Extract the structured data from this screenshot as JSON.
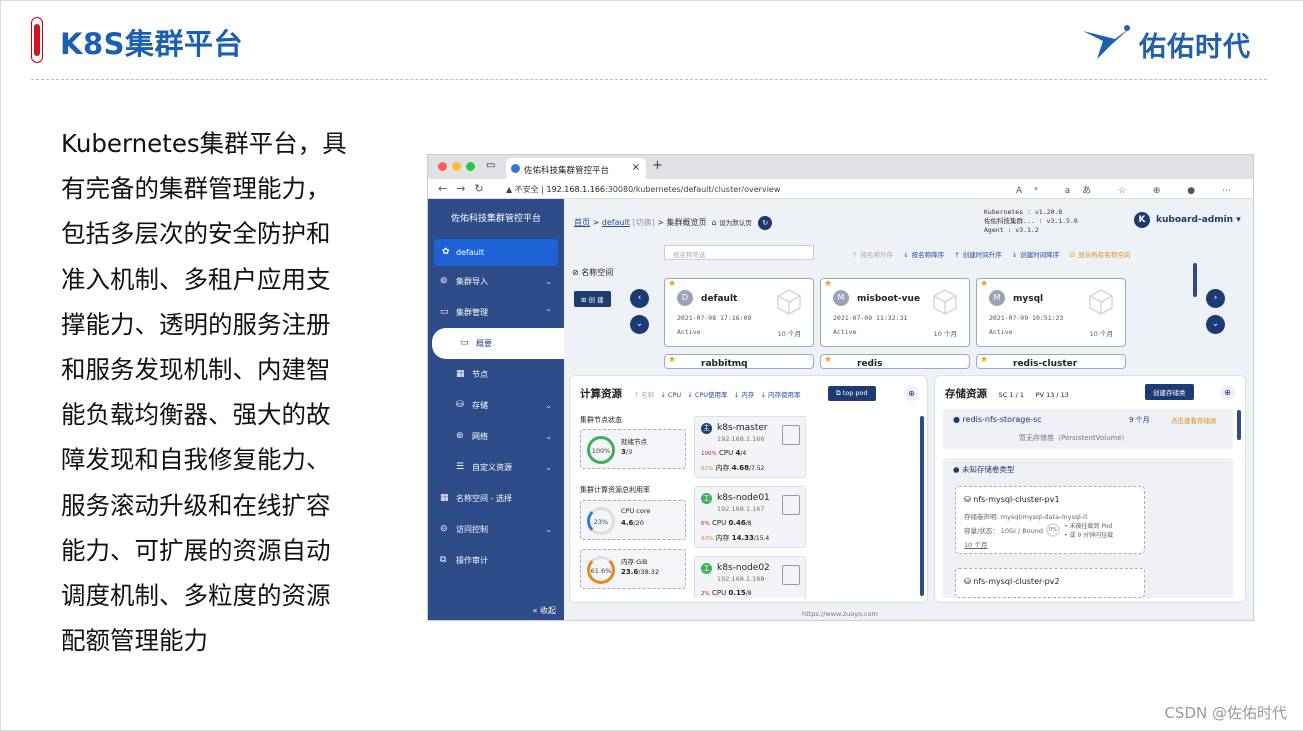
{
  "slide": {
    "title": "K8S集群平台",
    "logo_text": "佑佑时代",
    "body_lines": [
      "Kubernetes集群平台，具",
      "有完备的集群管理能力，",
      "包括多层次的安全防护和",
      "准入机制、多租户应用支",
      "撑能力、透明的服务注册",
      "和服务发现机制、内建智",
      "能负载均衡器、强大的故",
      "障发现和自我修复能力、",
      "服务滚动升级和在线扩容",
      "能力、可扩展的资源自动",
      "调度机制、多粒度的资源",
      "配额管理能力"
    ],
    "footer": "CSDN @佐佑时代"
  },
  "browser": {
    "tab_title": "佐佑科技集群管控平台",
    "insecure": "不安全",
    "url_host": "192.168.1.166",
    "url_rest": ":30080/kubernetes/default/cluster/overview",
    "status_url": "https://www.zuoyo.com"
  },
  "sidebar": {
    "brand": "佐佑科技集群管控平台",
    "selected_ns": "default",
    "items": [
      "集群导入",
      "集群管理",
      "概要",
      "节点",
      "存储",
      "网络",
      "自定义资源",
      "名称空间 - 选择",
      "访问控制",
      "操作审计"
    ],
    "collapse": "« 收起"
  },
  "header": {
    "bc_home": "首页",
    "bc_ns": "default",
    "bc_switch": "[切换]",
    "bc_page": "集群概览页",
    "bc_set_default": "设为默认页",
    "versions": [
      "Kubernetes    :  v1.20.8",
      "佐佑科技集群...  :  v3.1.5.0",
      "Agent         :  v3.1.2"
    ],
    "user": "kuboard-admin",
    "user_initial": "K"
  },
  "namespaces": {
    "label": "名称空间",
    "create": "创 建",
    "search_placeholder": "按名称筛选",
    "sorts": [
      "↑ 按名称升序",
      "↓ 按名称降序",
      "↑ 创建时间升序",
      "↓ 创建时间降序",
      "显示所有名称空间"
    ],
    "cards": [
      {
        "initial": "D",
        "name": "default",
        "created": "2021-07-08 17:16:09",
        "status": "Active",
        "age": "10 个月"
      },
      {
        "initial": "M",
        "name": "misboot-vue",
        "created": "2021-07-09 11:32:31",
        "status": "Active",
        "age": "10 个月"
      },
      {
        "initial": "M",
        "name": "mysql",
        "created": "2021-07-09 10:51:23",
        "status": "Active",
        "age": "10 个月"
      }
    ],
    "partial_cards": [
      "rabbitmq",
      "redis",
      "redis-cluster"
    ]
  },
  "compute": {
    "title": "计算资源",
    "sorts": [
      "↑ 名称",
      "↓ CPU",
      "↓ CPU使用率",
      "↓ 内存",
      "↓ 内存使用率"
    ],
    "top_pod": "top pod",
    "node_status_label": "集群节点状态",
    "ready_nodes": {
      "label": "就绪节点",
      "pct": "100%",
      "value": "3",
      "total": "/3"
    },
    "total_usage_label": "集群计算资源总利用率",
    "cpu": {
      "label": "CPU core",
      "pct": "23%",
      "value": "4.6",
      "total": "/20"
    },
    "mem": {
      "label": "内存 GiB",
      "pct": "61.6%",
      "value": "23.6",
      "total": "/38.32"
    },
    "nodes": [
      {
        "initial": "主",
        "name": "k8s-master",
        "ip": "192.168.1.166",
        "cpu_pct": "100%",
        "cpu": "4",
        "cpu_total": "/4",
        "mem_pct": "62%",
        "mem": "4.68",
        "mem_total": "/7.52"
      },
      {
        "initial": "工",
        "name": "k8s-node01",
        "ip": "192.168.1.167",
        "cpu_pct": "6%",
        "cpu": "0.46",
        "cpu_total": "/8",
        "mem_pct": "93%",
        "mem": "14.33",
        "mem_total": "/15.4"
      },
      {
        "initial": "工",
        "name": "k8s-node02",
        "ip": "192.168.1.168",
        "cpu_pct": "2%",
        "cpu": "0.15",
        "cpu_total": "/8"
      }
    ],
    "cpu_word": "CPU",
    "mem_word": "内存"
  },
  "storage": {
    "title": "存储资源",
    "sc": "SC 1 / 1",
    "pv": "PV 13 / 13",
    "create_btn": "创建存储类",
    "class_name": "redis-nfs-storage-sc",
    "class_age": "9 个月",
    "class_link": "点击查看存储类",
    "no_pv": "暂无存储卷（PersistentVolume）",
    "unknown_group": "未知存储卷类型",
    "pvs": [
      {
        "name": "nfs-mysql-cluster-pv1",
        "claim_label": "存储卷声明:",
        "claim": "mysql/mysql-data-mysql-0",
        "cap_label": "容量/状态：",
        "cap": "10Gi / Bound",
        "pct": "0%",
        "note1": "未被挂载到 Pod",
        "note2": "或 9 分钟内挂载",
        "age": "10 个月"
      },
      {
        "name": "nfs-mysql-cluster-pv2"
      }
    ]
  },
  "colors": {
    "accent": "#1f5fae",
    "sidebar": "#2f4c8a",
    "dark": "#1d3a73",
    "orange": "#e38a1f",
    "green": "#3fae5a",
    "red": "#d4141c"
  }
}
